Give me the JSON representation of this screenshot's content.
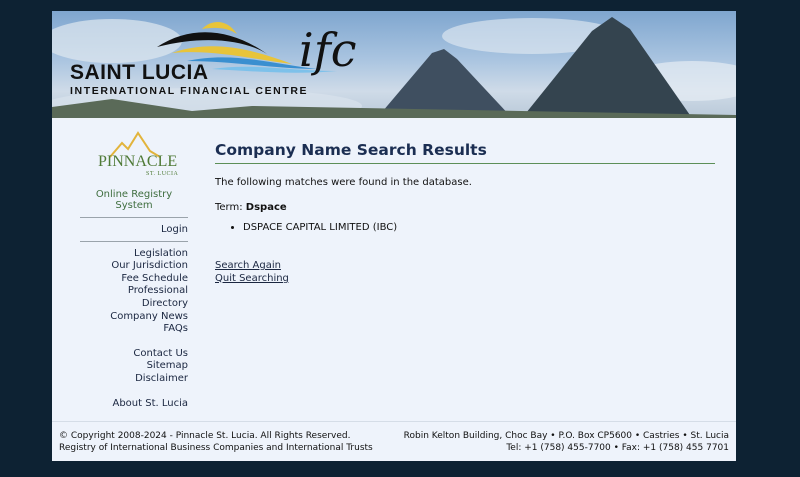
{
  "banner": {
    "brand_main": "SAINT LUCIA",
    "brand_sub": "INTERNATIONAL FINANCIAL CENTRE",
    "brand_mark": "ifc"
  },
  "sidebar": {
    "logo_word": "PINNACLE",
    "logo_sub": "ST. LUCIA",
    "registry_label": "Online Registry System",
    "login": "Login",
    "group1": [
      "Legislation",
      "Our Jurisdiction",
      "Fee Schedule",
      "Professional Directory",
      "Company News",
      "FAQs"
    ],
    "group2": [
      "Contact Us",
      "Sitemap",
      "Disclaimer"
    ],
    "group3": [
      "About St. Lucia"
    ]
  },
  "main": {
    "title": "Company Name Search Results",
    "intro": "The following matches were found in the database.",
    "term_label": "Term:",
    "term_value": "Dspace",
    "results": [
      "DSPACE CAPITAL LIMITED (IBC)"
    ],
    "search_again": "Search Again",
    "quit_searching": "Quit Searching"
  },
  "footer": {
    "left_line1": "© Copyright 2008-2024 - Pinnacle St. Lucia. All Rights Reserved.",
    "left_line2": "Registry of International Business Companies and International Trusts",
    "right_line1": "Robin Kelton Building, Choc Bay • P.O. Box CP5600 • Castries • St. Lucia",
    "right_line2": "Tel: +1 (758) 455-7700 • Fax: +1 (758) 455 7701"
  }
}
